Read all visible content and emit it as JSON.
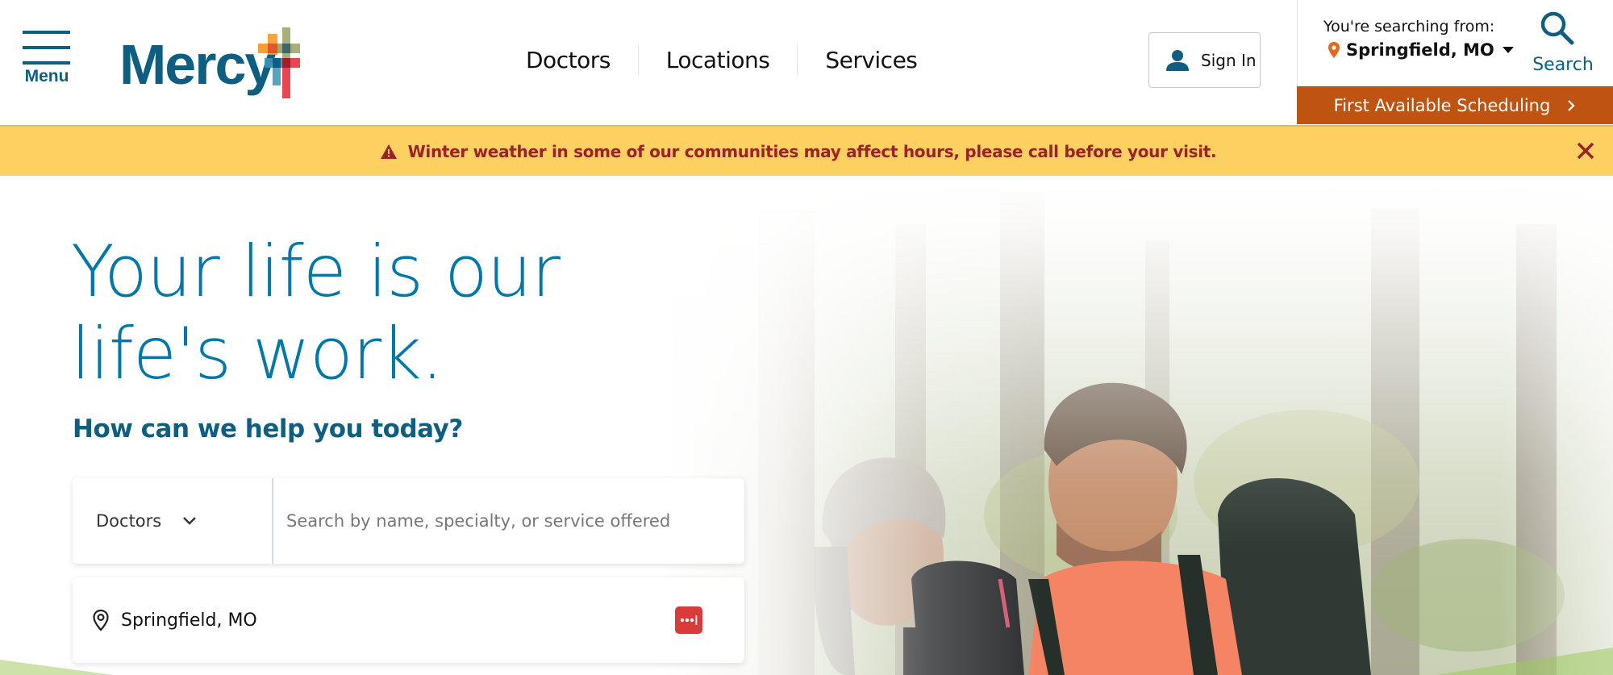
{
  "header": {
    "menu_label": "Menu",
    "logo_text": "Mercy",
    "nav": [
      {
        "label": "Doctors"
      },
      {
        "label": "Locations"
      },
      {
        "label": "Services"
      }
    ],
    "sign_in_label": "Sign In",
    "location_prompt": "You're searching from:",
    "location_value": "Springfield, MO",
    "search_label": "Search",
    "first_available_label": "First Available Scheduling"
  },
  "alert": {
    "message": "Winter weather in some of our communities may affect hours, please call before your visit."
  },
  "hero": {
    "headline_line1": "Your life is our",
    "headline_line2": "life's work.",
    "subheading": "How can we help you today?",
    "search": {
      "type_selected": "Doctors",
      "query_value": "",
      "query_placeholder": "Search by name, specialty, or service offered"
    },
    "location_input_value": "Springfield, MO"
  },
  "colors": {
    "brand_blue": "#0d5e80",
    "headline_blue": "#0077a9",
    "cta_orange": "#bf5312",
    "alert_bg": "#fdd161",
    "alert_text": "#9b2226",
    "password_manager_red": "#d93b3b"
  },
  "icons": {
    "menu": "hamburger-icon",
    "logo_mark": "cross-icon",
    "sign_in": "user-icon",
    "location": "map-pin-icon",
    "search": "search-icon",
    "cta": "chevron-right-icon",
    "alert": "warning-triangle-icon",
    "close": "close-icon",
    "select": "chevron-down-icon",
    "password_manager": "password-manager-icon"
  }
}
